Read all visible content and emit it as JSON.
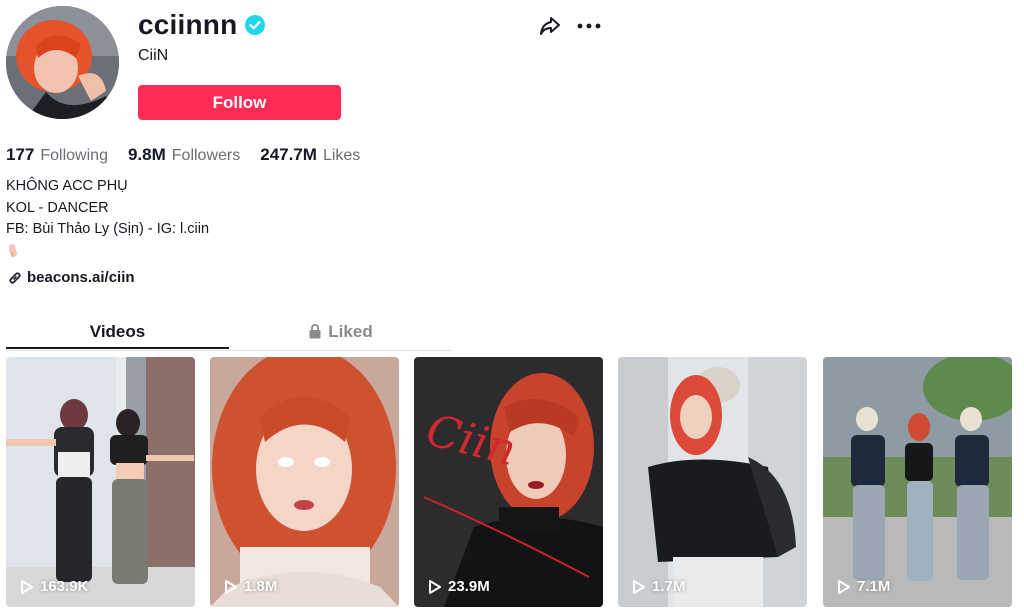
{
  "profile": {
    "username": "cciinnn",
    "nickname": "CiiN",
    "verified": true,
    "follow_label": "Follow"
  },
  "stats": [
    {
      "value": "177",
      "label": "Following"
    },
    {
      "value": "9.8M",
      "label": "Followers"
    },
    {
      "value": "247.7M",
      "label": "Likes"
    }
  ],
  "bio": {
    "lines": [
      "KHÔNG ACC PHỤ",
      "KOL - DANCER",
      "FB: Bùi Thảo Ly (Sịn) - IG: l.ciin"
    ],
    "emoji": "pointing-down-hand-icon"
  },
  "link": {
    "text": "beacons.ai/ciin",
    "icon": "link-icon"
  },
  "tabs": [
    {
      "label": "Videos",
      "active": true
    },
    {
      "label": "Liked",
      "active": false,
      "icon": "lock-icon"
    }
  ],
  "videos": [
    {
      "views": "163.9K"
    },
    {
      "views": "1.8M"
    },
    {
      "views": "23.9M",
      "overlay_text": "Ciin"
    },
    {
      "views": "1.7M"
    },
    {
      "views": "7.1M"
    }
  ],
  "colors": {
    "accent": "#fe2c55",
    "verified": "#20d5ec",
    "text": "#161823",
    "muted": "#6b6e76"
  }
}
